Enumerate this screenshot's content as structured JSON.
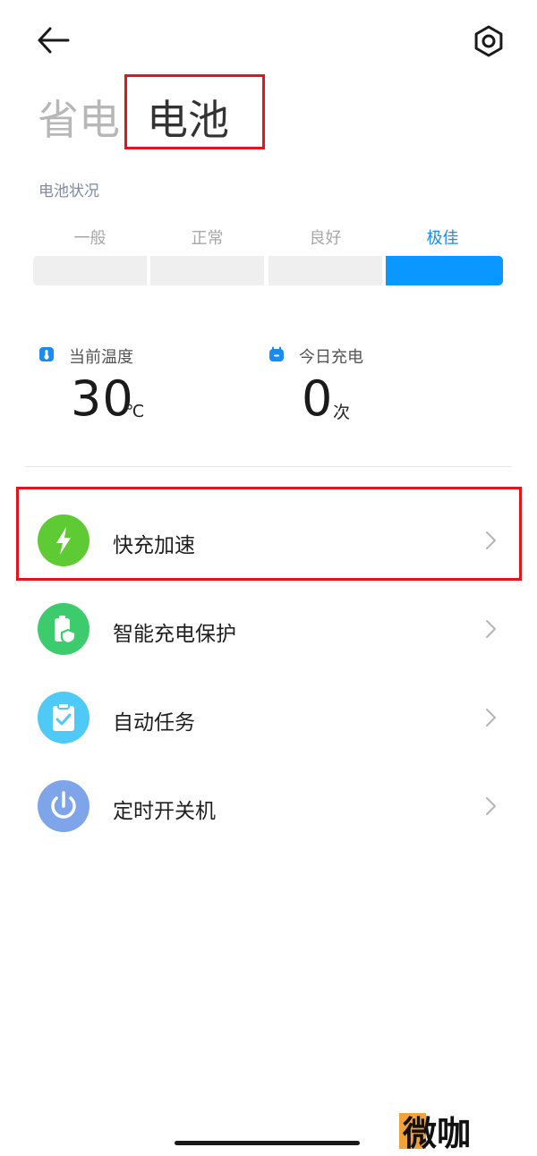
{
  "header": {
    "tabs": [
      {
        "label": "省电",
        "active": false
      },
      {
        "label": "电池",
        "active": true
      }
    ]
  },
  "battery_status": {
    "section_label": "电池状况",
    "levels": [
      "一般",
      "正常",
      "良好",
      "极佳"
    ],
    "active_level_index": 3
  },
  "stats": {
    "temperature": {
      "label": "当前温度",
      "value": "30",
      "unit": "℃"
    },
    "charges_today": {
      "label": "今日充电",
      "value": "0",
      "unit": "次"
    }
  },
  "menu": {
    "items": [
      {
        "label": "快充加速",
        "icon": "lightning-icon",
        "color": "#5fcb34"
      },
      {
        "label": "智能充电保护",
        "icon": "battery-shield-icon",
        "color": "#3ccc6d"
      },
      {
        "label": "自动任务",
        "icon": "clipboard-check-icon",
        "color": "#4fc9f6"
      },
      {
        "label": "定时开关机",
        "icon": "power-icon",
        "color": "#7ea4ea"
      }
    ]
  },
  "watermark": {
    "text": "微咖"
  },
  "colors": {
    "accent_blue": "#0a97ff",
    "highlight_red": "#e5141c"
  }
}
